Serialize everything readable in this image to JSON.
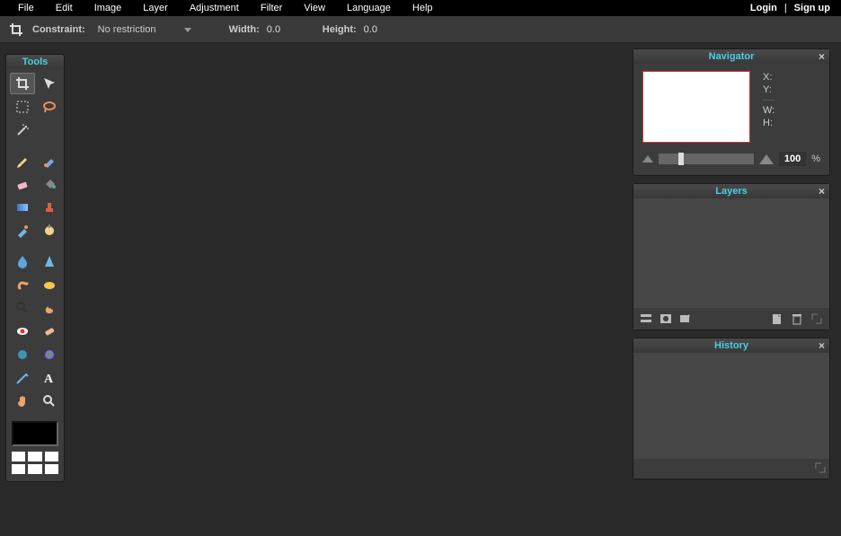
{
  "menu": {
    "items": [
      "File",
      "Edit",
      "Image",
      "Layer",
      "Adjustment",
      "Filter",
      "View",
      "Language",
      "Help"
    ],
    "login": "Login",
    "sep": "|",
    "signup": "Sign up"
  },
  "options": {
    "constraint_label": "Constraint:",
    "constraint_value": "No restriction",
    "width_label": "Width:",
    "width_value": "0.0",
    "height_label": "Height:",
    "height_value": "0.0"
  },
  "tools": {
    "title": "Tools",
    "items": [
      "crop",
      "move",
      "marquee",
      "lasso",
      "wand",
      "",
      "pencil",
      "brush",
      "eraser",
      "paint-bucket",
      "gradient",
      "clone-stamp",
      "color-replace",
      "color-picker",
      "blur",
      "sharpen",
      "smudge",
      "sponge",
      "dodge",
      "burn",
      "redeye",
      "healing",
      "bloat",
      "pinch",
      "draw",
      "type",
      "hand",
      "zoom"
    ]
  },
  "navigator": {
    "title": "Navigator",
    "x": "X:",
    "y": "Y:",
    "w": "W:",
    "h": "H:",
    "zoom": "100",
    "pct": "%"
  },
  "layers": {
    "title": "Layers"
  },
  "history": {
    "title": "History"
  }
}
